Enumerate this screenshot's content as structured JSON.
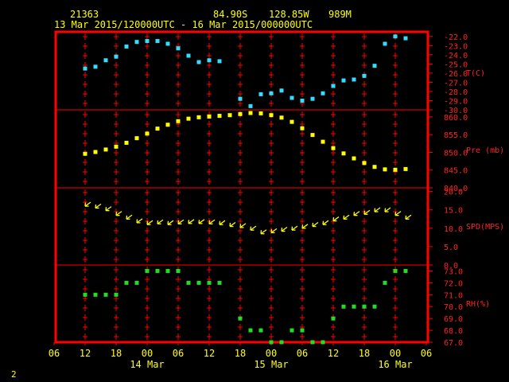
{
  "header": {
    "station": "21363",
    "lat": "84.90S",
    "lon": "128.85W",
    "elev": "989M",
    "period": "13 Mar 2015/120000UTC - 16 Mar 2015/000000UTC"
  },
  "corner_label": "2",
  "colors": {
    "frame": "#ff0000",
    "grid": "#ff0000",
    "temp": "#33ddff",
    "pres": "#ffff00",
    "wind": "#ffff00",
    "rh": "#22dd22",
    "text": "#ffff00",
    "panel_label": "#ff2222"
  },
  "chart_data": [
    {
      "type": "scatter",
      "panel": "temperature",
      "ylabel": "T(C)",
      "ylim": [
        -30,
        -21.5
      ],
      "yticks": [
        "-22.0",
        "-23.0",
        "-24.0",
        "-25.0",
        "-26.0",
        "-27.0",
        "-28.0",
        "-29.0",
        "-30.0"
      ],
      "x_hours": [
        0,
        2,
        4,
        6,
        8,
        10,
        12,
        14,
        16,
        18,
        20,
        22,
        24,
        26,
        28,
        30,
        32,
        34,
        36,
        38,
        40,
        42,
        44,
        46,
        48,
        50,
        52,
        54,
        56,
        58,
        60,
        62
      ],
      "values": [
        -25.5,
        -25.3,
        -24.6,
        -24.2,
        -23.1,
        -22.6,
        -22.5,
        -22.5,
        -22.8,
        -23.3,
        -24.1,
        -24.8,
        -24.6,
        -24.7,
        null,
        -28.8,
        -29.6,
        -28.3,
        -28.2,
        -27.9,
        -28.7,
        -29.0,
        -28.8,
        -28.2,
        -27.4,
        -26.8,
        -26.7,
        -26.3,
        -25.2,
        -22.8,
        -22.0,
        -22.2
      ]
    },
    {
      "type": "scatter",
      "panel": "pressure",
      "ylabel": "Pre (mb)",
      "ylim": [
        840,
        862
      ],
      "yticks": [
        "840.0",
        "845.0",
        "850.0",
        "855.0",
        "860.0"
      ],
      "x_hours": [
        0,
        2,
        4,
        6,
        8,
        10,
        12,
        14,
        16,
        18,
        20,
        22,
        24,
        26,
        28,
        30,
        32,
        34,
        36,
        38,
        40,
        42,
        44,
        46,
        48,
        50,
        52,
        54,
        56,
        58,
        60,
        62
      ],
      "values": [
        849.6,
        850.1,
        850.8,
        851.6,
        852.7,
        854.0,
        855.3,
        856.7,
        857.8,
        858.8,
        859.5,
        859.9,
        860.1,
        860.3,
        860.5,
        860.8,
        861.1,
        861.0,
        860.5,
        859.8,
        858.6,
        856.8,
        854.9,
        853.0,
        851.2,
        849.7,
        848.3,
        847.0,
        845.9,
        845.2,
        845.1,
        845.3,
        845.6
      ]
    },
    {
      "type": "scatter",
      "panel": "wind",
      "ylabel": "SPD(MPS)",
      "ylim": [
        0,
        21
      ],
      "yticks": [
        "0.0",
        "5.0",
        "10.0",
        "15.0",
        "20.0"
      ],
      "x_hours": [
        0,
        2,
        4,
        6,
        8,
        10,
        12,
        14,
        16,
        18,
        20,
        22,
        24,
        26,
        28,
        30,
        32,
        34,
        36,
        38,
        40,
        42,
        44,
        46,
        48,
        50,
        52,
        54,
        56,
        58,
        60,
        62
      ],
      "values": [
        16.0,
        15.5,
        14.8,
        13.5,
        12.5,
        11.5,
        11.0,
        11.2,
        11.0,
        11.2,
        11.3,
        11.3,
        11.2,
        11.0,
        10.5,
        10.2,
        9.5,
        8.5,
        8.8,
        9.2,
        9.5,
        10.0,
        10.5,
        11.0,
        12.0,
        12.5,
        13.5,
        13.8,
        14.5,
        14.5,
        13.5,
        12.5
      ]
    },
    {
      "type": "scatter",
      "panel": "humidity",
      "ylabel": "RH(%)",
      "ylim": [
        67,
        73.5
      ],
      "yticks": [
        "67.0",
        "68.0",
        "69.0",
        "70.0",
        "71.0",
        "72.0",
        "73.0"
      ],
      "x_hours": [
        0,
        2,
        4,
        6,
        8,
        10,
        12,
        14,
        16,
        18,
        20,
        22,
        24,
        26,
        28,
        30,
        32,
        34,
        36,
        38,
        40,
        42,
        44,
        46,
        48,
        50,
        52,
        54,
        56,
        58,
        60,
        62
      ],
      "values": [
        71,
        71,
        71,
        71,
        72,
        72,
        73,
        73,
        73,
        73,
        72,
        72,
        72,
        72,
        null,
        69,
        68,
        68,
        67,
        67,
        68,
        68,
        67,
        67,
        69,
        70,
        70,
        70,
        70,
        72,
        73,
        73,
        72
      ]
    }
  ],
  "x_axis": {
    "hour_labels": [
      "06",
      "12",
      "18",
      "00",
      "06",
      "12",
      "18",
      "00",
      "06",
      "12",
      "18",
      "00",
      "06"
    ],
    "date_labels": [
      "14 Mar",
      "15 Mar",
      "16 Mar"
    ]
  }
}
